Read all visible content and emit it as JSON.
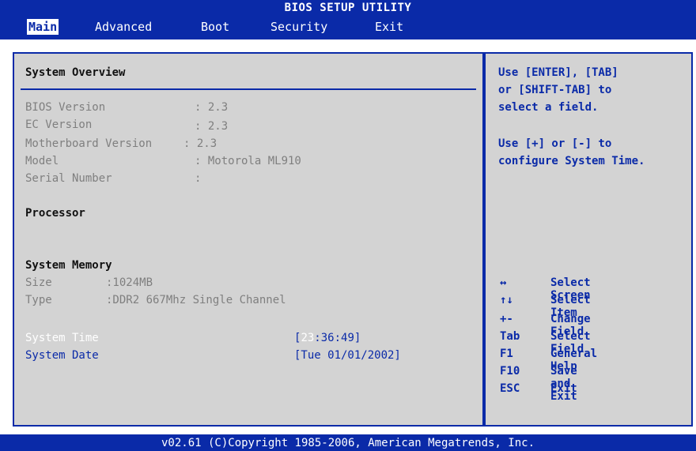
{
  "title": "BIOS SETUP UTILITY",
  "tabs": [
    {
      "label": "Main",
      "active": true
    },
    {
      "label": "Advanced"
    },
    {
      "label": "Boot"
    },
    {
      "label": "Security"
    },
    {
      "label": "Exit"
    }
  ],
  "overview": {
    "title": "System Overview",
    "bios_label": "BIOS Version",
    "bios_value": ": 2.3",
    "ec_label": "EC Version",
    "ec_value": ": 2.3",
    "mb_label": "Motherboard Version",
    "mb_value": ": 2.3",
    "model_label": "Model",
    "model_value": ": Motorola ML910",
    "serial_label": "Serial Number",
    "serial_value": ":"
  },
  "processor": {
    "title": "Processor"
  },
  "memory": {
    "title": "System Memory",
    "size_label": "Size",
    "size_value": ":1024MB",
    "type_label": "Type",
    "type_value": ":DDR2 667Mhz Single Channel"
  },
  "time": {
    "label": "System Time",
    "open": "[",
    "hour": "23",
    "rest": ":36:49]"
  },
  "date": {
    "label": "System Date",
    "value": "[Tue 01/01/2002]"
  },
  "help": {
    "line1": "Use [ENTER], [TAB]",
    "line2": "or [SHIFT-TAB] to",
    "line3": "select a field.",
    "line4": "Use [+] or [-] to",
    "line5": "configure System Time."
  },
  "keys": [
    {
      "key": "↔",
      "desc": "Select Screen"
    },
    {
      "key": "↑↓",
      "desc": "Select Item"
    },
    {
      "key": "+-",
      "desc": "Change Field"
    },
    {
      "key": "Tab",
      "desc": "Select Field"
    },
    {
      "key": "F1",
      "desc": "General Help"
    },
    {
      "key": "F10",
      "desc": "Save and Exit"
    },
    {
      "key": "ESC",
      "desc": "Exit"
    }
  ],
  "footer": "v02.61 (C)Copyright 1985-2006, American Megatrends, Inc.",
  "colors": {
    "bios_blue": "#0a2aa8",
    "panel_grey": "#d3d3d3",
    "text_grey": "#7f7f7f",
    "white": "#ffffff"
  }
}
